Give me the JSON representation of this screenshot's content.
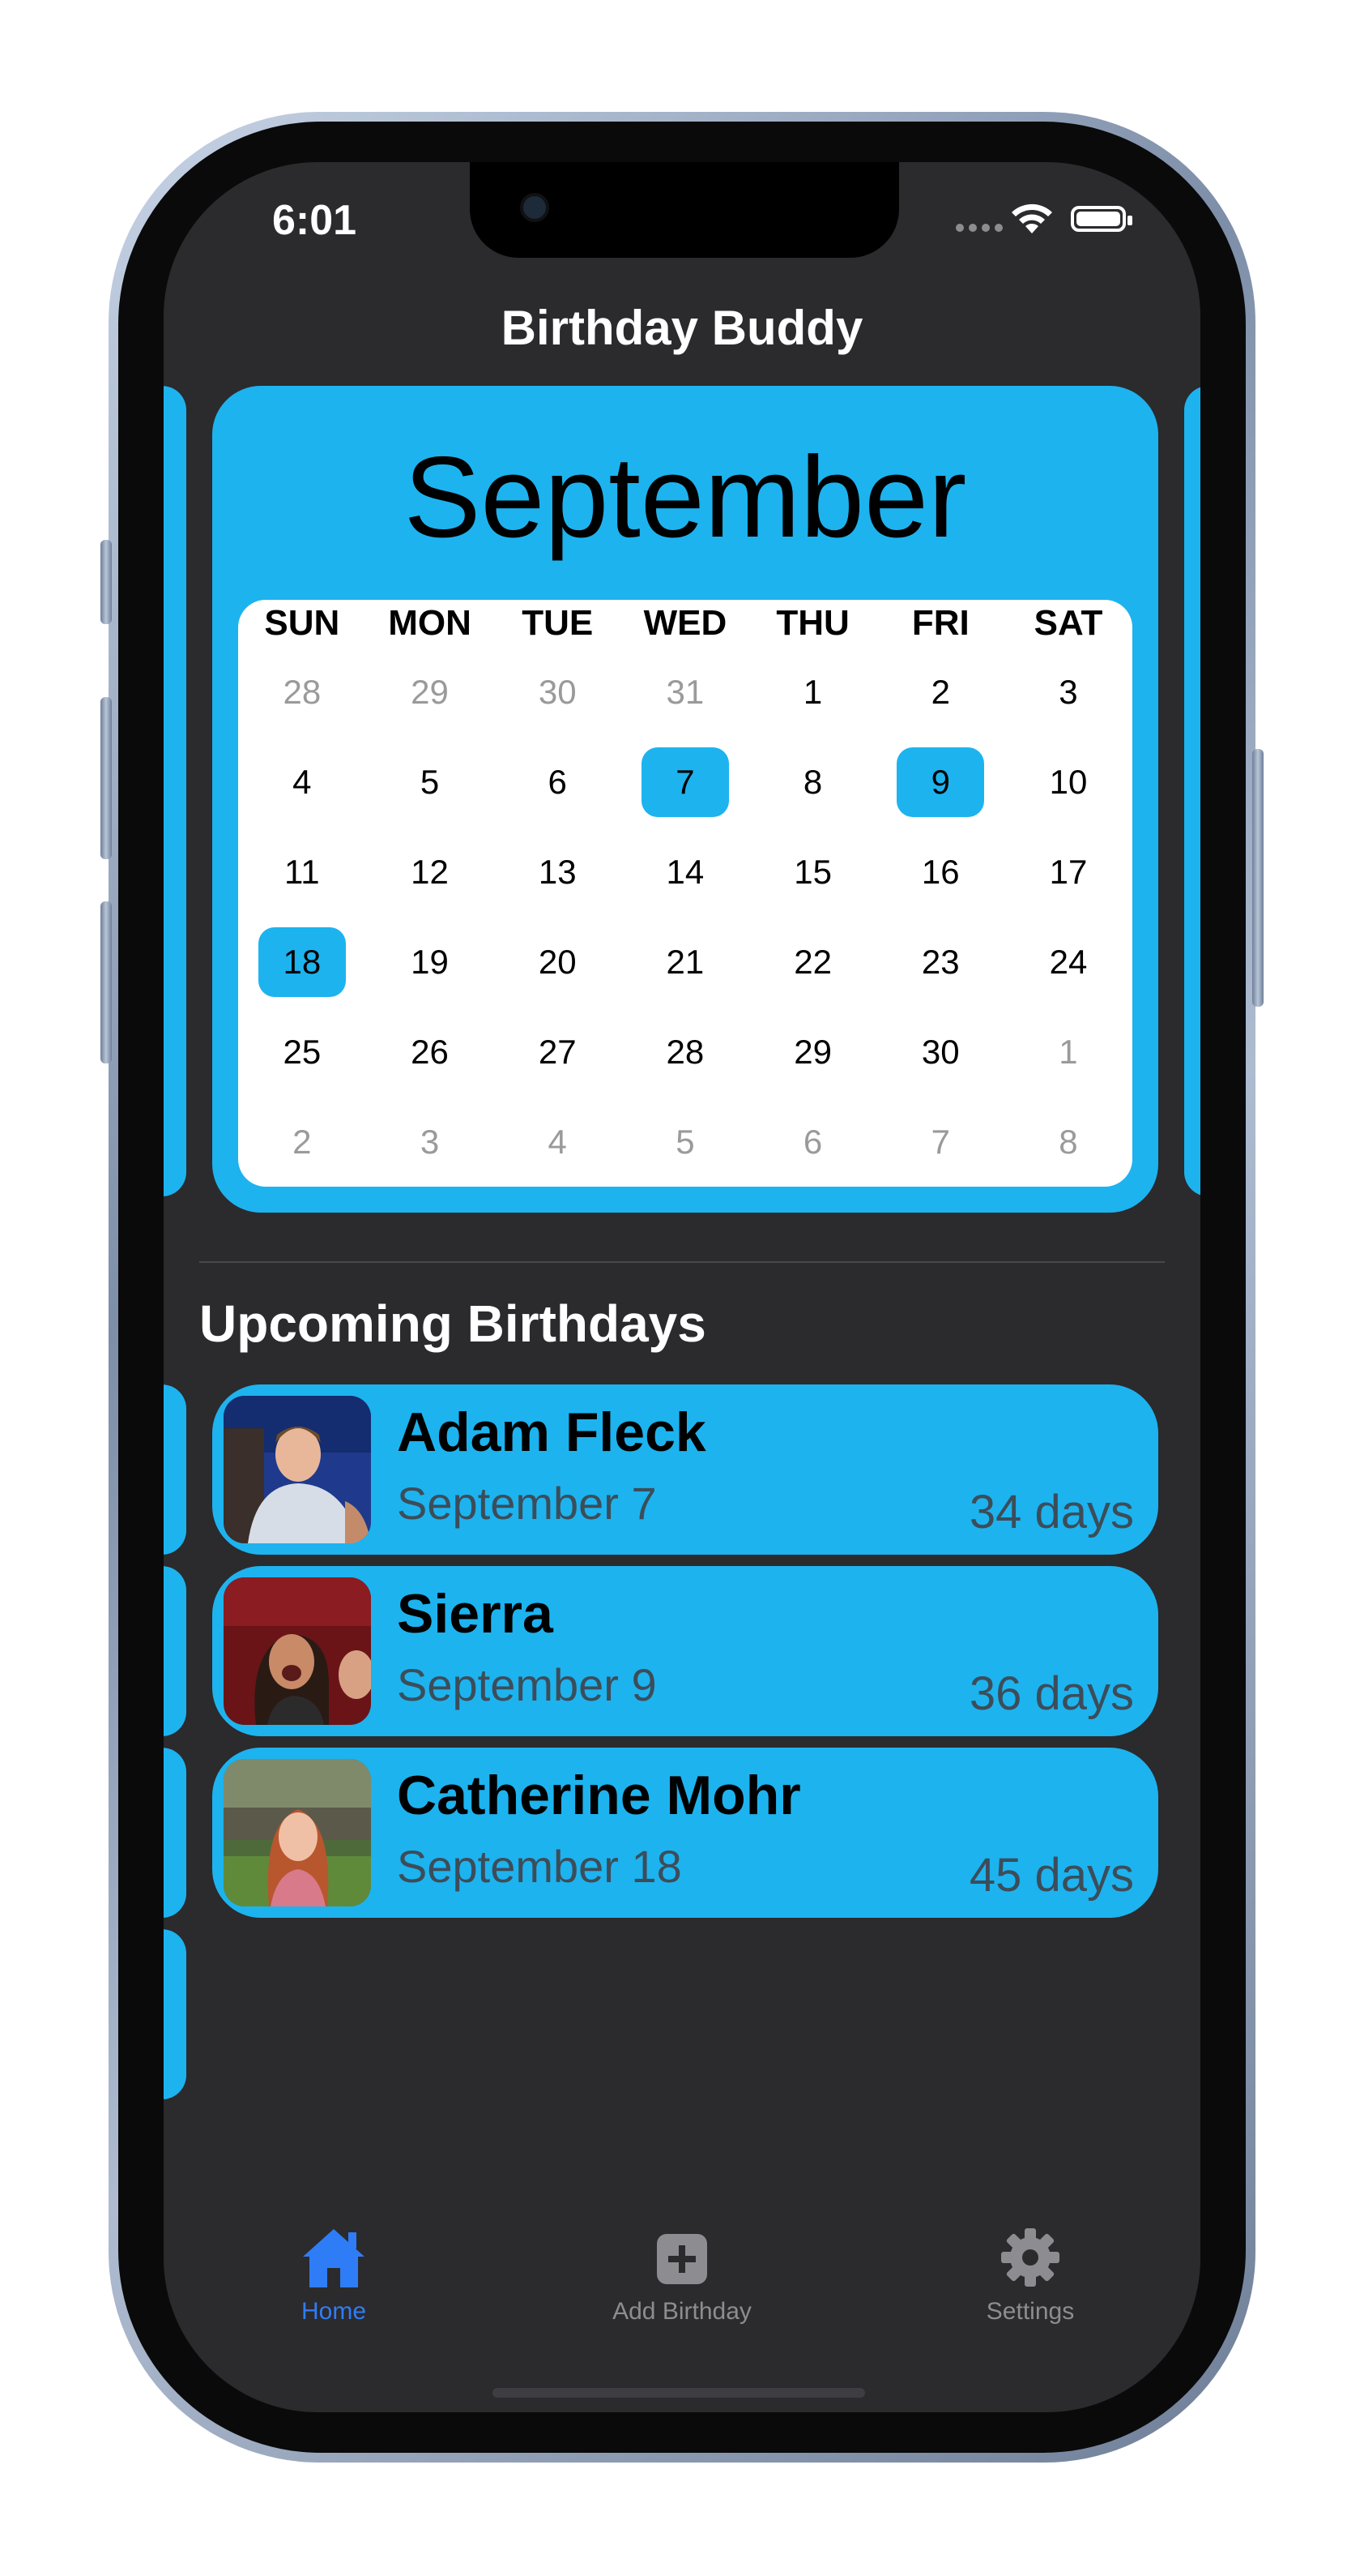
{
  "status": {
    "time": "6:01"
  },
  "nav": {
    "title": "Birthday Buddy"
  },
  "calendar": {
    "month": "September",
    "weekdays": [
      "SUN",
      "MON",
      "TUE",
      "WED",
      "THU",
      "FRI",
      "SAT"
    ],
    "weeks": [
      [
        {
          "d": "28",
          "o": true
        },
        {
          "d": "29",
          "o": true
        },
        {
          "d": "30",
          "o": true
        },
        {
          "d": "31",
          "o": true
        },
        {
          "d": "1"
        },
        {
          "d": "2"
        },
        {
          "d": "3"
        }
      ],
      [
        {
          "d": "4"
        },
        {
          "d": "5"
        },
        {
          "d": "6"
        },
        {
          "d": "7",
          "h": true
        },
        {
          "d": "8"
        },
        {
          "d": "9",
          "h": true
        },
        {
          "d": "10"
        }
      ],
      [
        {
          "d": "11"
        },
        {
          "d": "12"
        },
        {
          "d": "13"
        },
        {
          "d": "14"
        },
        {
          "d": "15"
        },
        {
          "d": "16"
        },
        {
          "d": "17"
        }
      ],
      [
        {
          "d": "18",
          "h": true
        },
        {
          "d": "19"
        },
        {
          "d": "20"
        },
        {
          "d": "21"
        },
        {
          "d": "22"
        },
        {
          "d": "23"
        },
        {
          "d": "24"
        }
      ],
      [
        {
          "d": "25"
        },
        {
          "d": "26"
        },
        {
          "d": "27"
        },
        {
          "d": "28"
        },
        {
          "d": "29"
        },
        {
          "d": "30"
        },
        {
          "d": "1",
          "o": true
        }
      ],
      [
        {
          "d": "2",
          "o": true
        },
        {
          "d": "3",
          "o": true
        },
        {
          "d": "4",
          "o": true
        },
        {
          "d": "5",
          "o": true
        },
        {
          "d": "6",
          "o": true
        },
        {
          "d": "7",
          "o": true
        },
        {
          "d": "8",
          "o": true
        }
      ]
    ]
  },
  "upcoming": {
    "title": "Upcoming Birthdays",
    "items": [
      {
        "name": "Adam Fleck",
        "date": "September 7",
        "days": "34 days"
      },
      {
        "name": "Sierra",
        "date": "September 9",
        "days": "36 days"
      },
      {
        "name": "Catherine Mohr",
        "date": "September 18",
        "days": "45 days"
      }
    ]
  },
  "tabs": [
    {
      "label": "Home",
      "icon": "house-icon",
      "active": true
    },
    {
      "label": "Add Birthday",
      "icon": "plus-square-icon",
      "active": false
    },
    {
      "label": "Settings",
      "icon": "gear-icon",
      "active": false
    }
  ],
  "colors": {
    "accent": "#1db3ef",
    "background": "#2b2a2d",
    "active_tab": "#2f7df6",
    "inactive_tab": "#8d8d91"
  }
}
